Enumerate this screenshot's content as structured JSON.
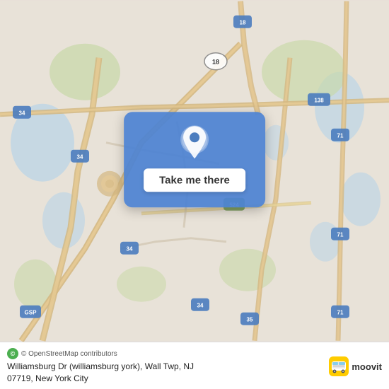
{
  "map": {
    "alt": "Map of Wall Township, NJ area",
    "center_lat": 40.15,
    "center_lng": -74.07
  },
  "card": {
    "button_label": "Take me there"
  },
  "bottom_bar": {
    "attribution": "© OpenStreetMap contributors",
    "address_line1": "Williamsburg Dr (williamsburg york), Wall Twp, NJ",
    "address_line2": "07719, New York City",
    "moovit_label": "moovit"
  }
}
